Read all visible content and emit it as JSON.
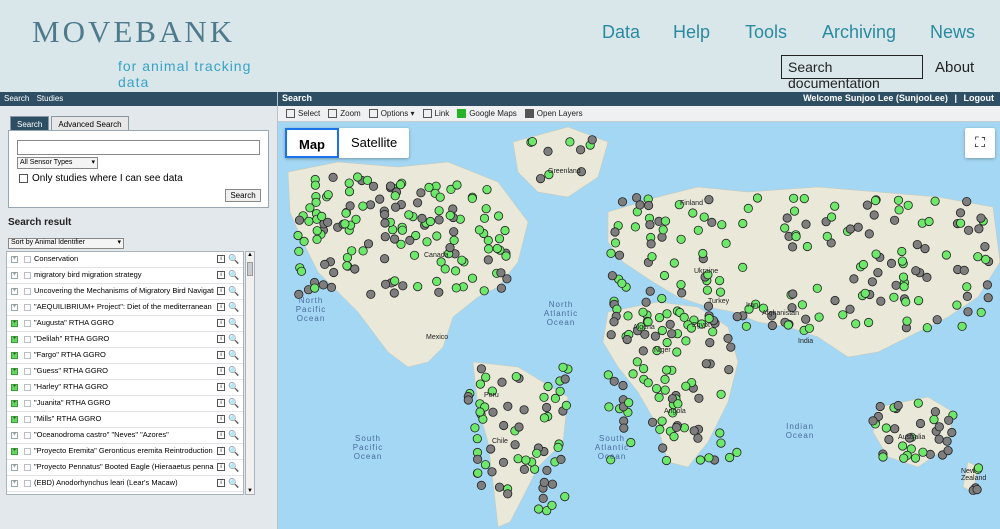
{
  "brand": {
    "word": "MOVEBANK",
    "tagline": "for animal tracking data"
  },
  "topnav": {
    "data": "Data",
    "help": "Help",
    "tools": "Tools",
    "archiving": "Archiving",
    "news": "News"
  },
  "header": {
    "search_doc": "Search documentation",
    "about": "About"
  },
  "left": {
    "crumbs": [
      "Search",
      "Studies"
    ],
    "tabs": [
      "Search",
      "Advanced Search"
    ],
    "query_value": "",
    "sensor_select": "All Sensor Types",
    "only_visible": "Only studies where I can see data",
    "search_button": "Search",
    "results_title": "Search result",
    "sort_select": "Sort by Animal Identifier",
    "results": [
      {
        "name": "Conservation",
        "green": false
      },
      {
        "name": "migratory bird migration strategy",
        "green": false
      },
      {
        "name": "Uncovering the Mechanisms of Migratory Bird Navigati",
        "green": false
      },
      {
        "name": "\"AEQUILIBRIUM+ Project\": Diet of the mediterranean",
        "green": false
      },
      {
        "name": "\"Augusta\" RTHA GGRO",
        "green": true
      },
      {
        "name": "\"Delilah\" RTHA GGRO",
        "green": true
      },
      {
        "name": "\"Fargo\" RTHA GGRO",
        "green": true
      },
      {
        "name": "\"Guess\" RTHA GGRO",
        "green": true
      },
      {
        "name": "\"Harley\" RTHA GGRO",
        "green": true
      },
      {
        "name": "\"Juanita\" RTHA GGRO",
        "green": true
      },
      {
        "name": "\"Mills\" RTHA GGRO",
        "green": true
      },
      {
        "name": "\"Oceanodroma castro\" \"Neves\" \"Azores\"",
        "green": false
      },
      {
        "name": "\"Proyecto Eremita\" Geronticus eremita Reintroduction",
        "green": true
      },
      {
        "name": "\"Proyecto Pennatus\" Booted Eagle (Hieraaetus penna",
        "green": false
      },
      {
        "name": "(EBD) Anodorhynchus leari (Lear's Macaw)",
        "green": false
      }
    ]
  },
  "mapbar": {
    "title": "Search",
    "welcome": "Welcome Sunjoo Lee (SunjooLee)",
    "sep": "|",
    "logout": "Logout"
  },
  "maptools": {
    "select": "Select",
    "zoom": "Zoom",
    "options": "Options",
    "link": "Link",
    "google": "Google Maps",
    "openlayers": "Open Layers"
  },
  "map": {
    "map_btn": "Map",
    "satellite_btn": "Satellite",
    "labels": {
      "greenland": "Greenland",
      "canada": "Canada",
      "mexico": "Mexico",
      "finland": "Finland",
      "ukraine": "Ukraine",
      "algeria": "Algeria",
      "egypt": "Egypt",
      "niger": "Niger",
      "afghanistan": "Afghanistan",
      "india": "India",
      "angola": "Angola",
      "chile": "Chile",
      "australia": "Australia",
      "new_zealand": "New Zealand",
      "turkey": "Turkey",
      "iran": "Iran",
      "peru": "Peru"
    },
    "oceans": {
      "npac": "North Pacific Ocean",
      "natl": "North Atlantic Ocean",
      "spac": "South Pacific Ocean",
      "satl": "South Atlantic Ocean",
      "indian": "Indian Ocean"
    },
    "colors": {
      "water": "#a4d7f3",
      "land": "#e9e8d9",
      "green_pin": "#6ee86a",
      "grey_pin": "#7e7e7e"
    }
  }
}
